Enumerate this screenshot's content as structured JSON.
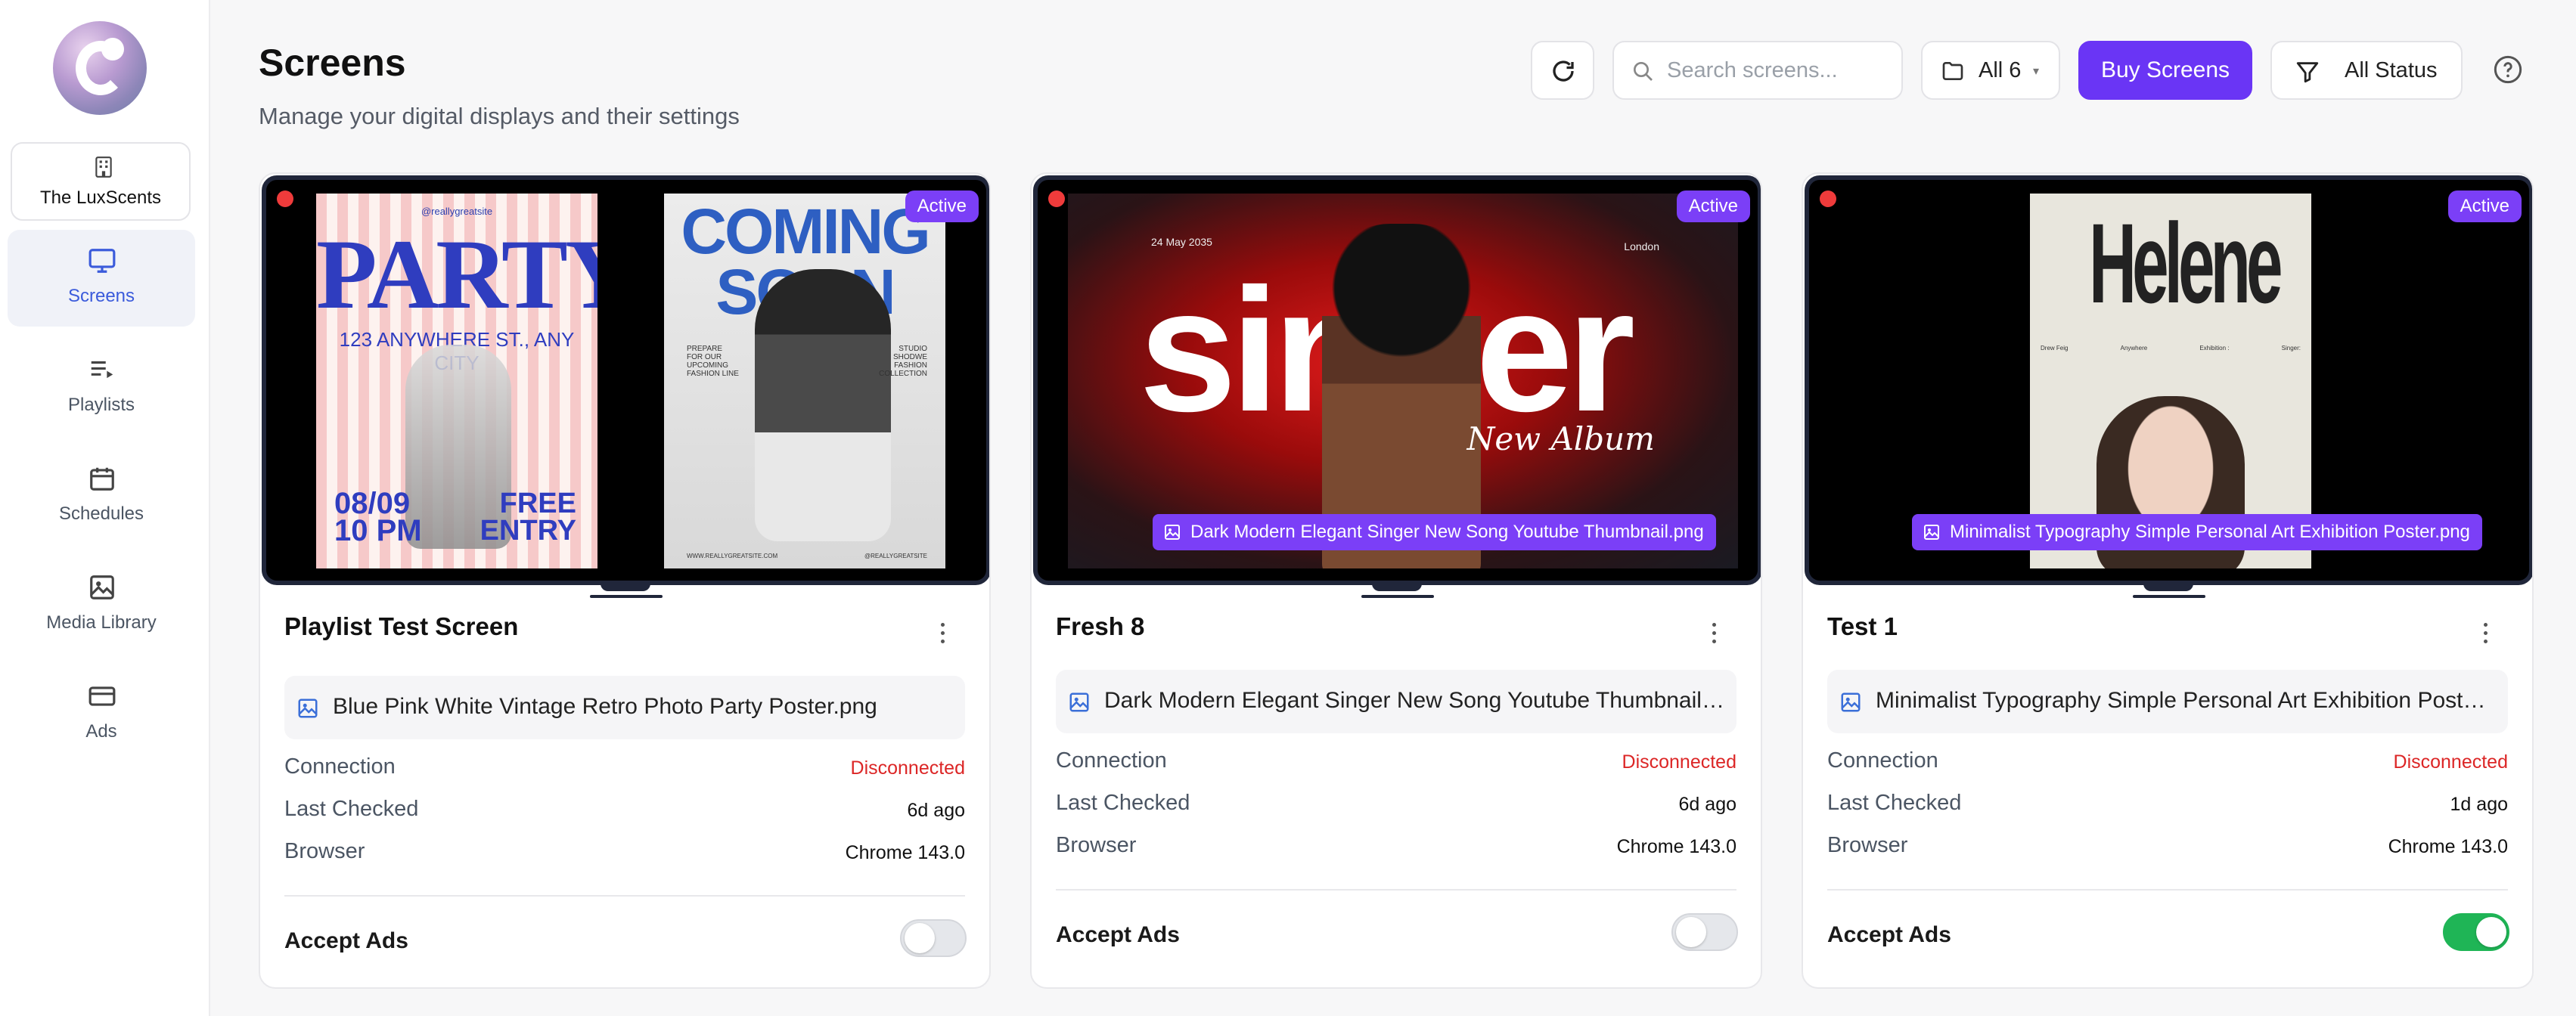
{
  "sidebar": {
    "logo_icon": "luxscents-logo",
    "org_switch": {
      "icon": "building-icon",
      "label": "The LuxScents"
    },
    "items": [
      {
        "label": "Screens",
        "icon": "monitor-icon",
        "active": true
      },
      {
        "label": "Playlists",
        "icon": "playlist-icon",
        "active": false
      },
      {
        "label": "Schedules",
        "icon": "calendar-icon",
        "active": false
      },
      {
        "label": "Media Library",
        "icon": "image-icon",
        "active": false
      },
      {
        "label": "Ads",
        "icon": "card-icon",
        "active": false
      }
    ]
  },
  "header": {
    "title": "Screens",
    "subtitle": "Manage your digital displays and their settings",
    "search_placeholder": "Search screens...",
    "folder_filter": "All 6",
    "buy_button": "Buy Screens",
    "status_filter": "All Status"
  },
  "colors": {
    "accent": "#6a35f5",
    "badge": "#7b3ff7",
    "disconnected": "#dc2626",
    "toggle_on": "#1fb556"
  },
  "labels": {
    "connection": "Connection",
    "last_checked": "Last Checked",
    "browser": "Browser",
    "accept_ads": "Accept Ads"
  },
  "screens": [
    {
      "name": "Playlist Test Screen",
      "badge": "Active",
      "media": "Blue Pink White Vintage Retro Photo Party Poster.png",
      "overlay_file": "",
      "connection": "Disconnected",
      "last_checked": "6d ago",
      "browser": "Chrome 143.0",
      "accept_ads": false
    },
    {
      "name": "Fresh 8",
      "badge": "Active",
      "media": "Dark Modern Elegant Singer New Song Youtube Thumbnail.png",
      "overlay_file": "Dark Modern Elegant Singer New Song Youtube Thumbnail.png",
      "connection": "Disconnected",
      "last_checked": "6d ago",
      "browser": "Chrome 143.0",
      "accept_ads": false
    },
    {
      "name": "Test 1",
      "badge": "Active",
      "media": "Minimalist Typography Simple Personal Art Exhibition Poster.png",
      "overlay_file": "Minimalist Typography Simple Personal Art Exhibition Poster.png",
      "connection": "Disconnected",
      "last_checked": "1d ago",
      "browser": "Chrome 143.0",
      "accept_ads": true
    }
  ],
  "artwork": {
    "party": {
      "handle": "@reallygreatsite",
      "title": "PARTY",
      "address": "123 ANYWHERE ST., ANY CITY",
      "date_line1": "08/09",
      "date_line2": "10 PM",
      "free_line1": "FREE",
      "free_line2": "ENTRY"
    },
    "soon": {
      "title_line1": "COMING",
      "title_line2": "SOON",
      "left_text": "PREPARE FOR OUR UPCOMING FASHION LINE",
      "right_text": "STUDIO SHODWE FASHION COLLECTION",
      "footer_left": "WWW.REALLYGREATSITE.COM",
      "footer_right": "@REALLYGREATSITE"
    },
    "singer": {
      "date": "24 May 2035",
      "city": "London",
      "word": "singer",
      "script": "New Album"
    },
    "helene": {
      "title": "Helene",
      "info": [
        "Drew Feig",
        "Anywhere",
        "Exhibition :",
        "Singer:"
      ]
    }
  }
}
